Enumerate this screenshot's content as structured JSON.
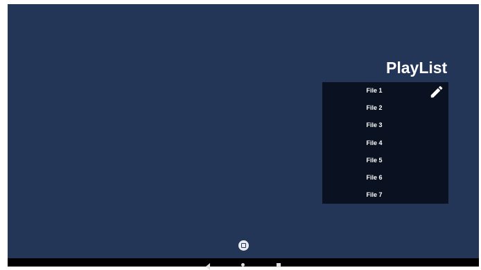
{
  "playlist": {
    "title": "PlayList",
    "files": [
      "File 1",
      "File 2",
      "File 3",
      "File 4",
      "File 5",
      "File 6",
      "File 7"
    ],
    "edit_icon": "pencil-icon"
  },
  "colors": {
    "background": "#233657",
    "panel": "#0a1120",
    "text": "#ffffff",
    "nav_bar": "#000000"
  },
  "navigation": {
    "floating_button_icon": "home-circle-icon",
    "buttons": [
      "back-icon",
      "home-icon",
      "recents-icon"
    ]
  }
}
